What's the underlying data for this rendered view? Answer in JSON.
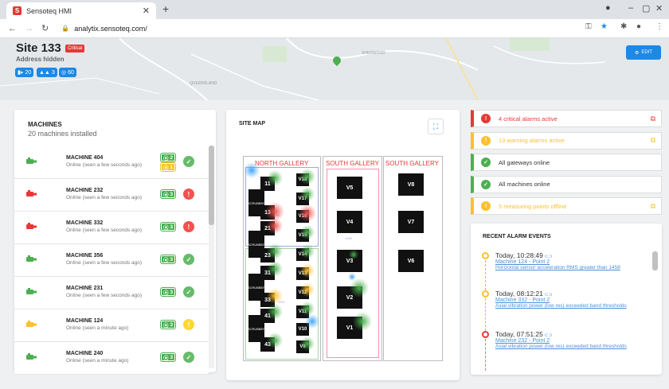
{
  "browser": {
    "tab_title": "Sensoteq HMI",
    "favicon_letter": "S",
    "new_tab": "+",
    "url": "analytix.sensoteq.com/"
  },
  "site": {
    "title": "Site 133",
    "critical_label": "Critical",
    "address": "Address hidden",
    "chips": [
      {
        "value": "20",
        "color": "#1e88e5"
      },
      {
        "value": "3",
        "color": "#1e88e5"
      },
      {
        "value": "60",
        "color": "#1e88e5"
      }
    ],
    "edit_label": "EDIT",
    "map_labels": [
      "QUEENSLAND",
      "SHERWOOD"
    ]
  },
  "machines": {
    "title": "MACHINES",
    "subtitle": "20 machines installed",
    "items": [
      {
        "name": "MACHINE 404",
        "status": "Online (seen a few seconds ago)",
        "icon_color": "#4caf50",
        "badges": [
          {
            "text": "2",
            "color": "#4caf50"
          },
          {
            "text": "1",
            "color": "#fbc02d"
          }
        ],
        "state": "ok"
      },
      {
        "name": "MACHINE 232",
        "status": "Online (seen a few seconds ago)",
        "icon_color": "#e53935",
        "badges": [
          {
            "text": "3",
            "color": "#4caf50"
          }
        ],
        "state": "critical"
      },
      {
        "name": "MACHINE 332",
        "status": "Online (seen a few seconds ago)",
        "icon_color": "#e53935",
        "badges": [
          {
            "text": "3",
            "color": "#4caf50"
          }
        ],
        "state": "critical"
      },
      {
        "name": "MACHINE 356",
        "status": "Online (seen a few seconds ago)",
        "icon_color": "#4caf50",
        "badges": [
          {
            "text": "3",
            "color": "#4caf50"
          }
        ],
        "state": "ok"
      },
      {
        "name": "MACHINE 231",
        "status": "Online (seen a few seconds ago)",
        "icon_color": "#4caf50",
        "badges": [
          {
            "text": "3",
            "color": "#4caf50"
          }
        ],
        "state": "ok"
      },
      {
        "name": "MACHINE 124",
        "status": "Online (seen a minute ago)",
        "icon_color": "#fbc02d",
        "badges": [
          {
            "text": "3",
            "color": "#4caf50"
          }
        ],
        "state": "warning"
      },
      {
        "name": "MACHINE 240",
        "status": "Online (seen a minute ago)",
        "icon_color": "#4caf50",
        "badges": [
          {
            "text": "3",
            "color": "#4caf50"
          }
        ],
        "state": "ok"
      }
    ]
  },
  "site_map": {
    "title": "SITE MAP",
    "galleries": [
      "NORTH GALLERY",
      "SOUTH GALLERY",
      "SOUTH GALLERY"
    ],
    "north_units": [
      "11",
      "13",
      "21",
      "23",
      "31",
      "33",
      "41",
      "43"
    ],
    "north_v": [
      "V18",
      "V17",
      "V16",
      "V15",
      "V14",
      "V13",
      "V12",
      "V11",
      "V10",
      "V9"
    ],
    "south_v": [
      "V5",
      "V4",
      "V3",
      "V2",
      "V1"
    ],
    "south2_v": [
      "V8",
      "V7",
      "V6"
    ],
    "scrubber_label": "SCRUBBER",
    "small_labels": [
      "1007",
      "1005",
      "1007"
    ]
  },
  "alerts": [
    {
      "text": "4 critical alarms active",
      "color": "#e53935",
      "icon": "!",
      "ext": true
    },
    {
      "text": "13 warning alarms active",
      "color": "#fbc02d",
      "icon": "!",
      "ext": true
    },
    {
      "text": "All gateways online",
      "color": "#4caf50",
      "icon": "✓",
      "ext": false
    },
    {
      "text": "All machines online",
      "color": "#4caf50",
      "icon": "✓",
      "ext": false
    },
    {
      "text": "5 measuring points offline",
      "color": "#fbc02d",
      "icon": "!",
      "ext": true
    }
  ],
  "events": {
    "title": "RECENT ALARM EVENTS",
    "items": [
      {
        "time": "Today, 10:28:49",
        "machine": "Machine 124",
        "point": "Point 2",
        "desc": "Horizontal sensor acceleration RMS greater than 1458",
        "color": "#fbc02d"
      },
      {
        "time": "Today, 08:12:21",
        "machine": "Machine 332",
        "point": "Point 2",
        "desc": "Axial vibration power (low res) exceeded band thresholds",
        "color": "#fbc02d"
      },
      {
        "time": "Today, 07:51:25",
        "machine": "Machine 232",
        "point": "Point 2",
        "desc": "Axial vibration power (low res) exceeded band thresholds",
        "color": "#e53935"
      }
    ]
  }
}
